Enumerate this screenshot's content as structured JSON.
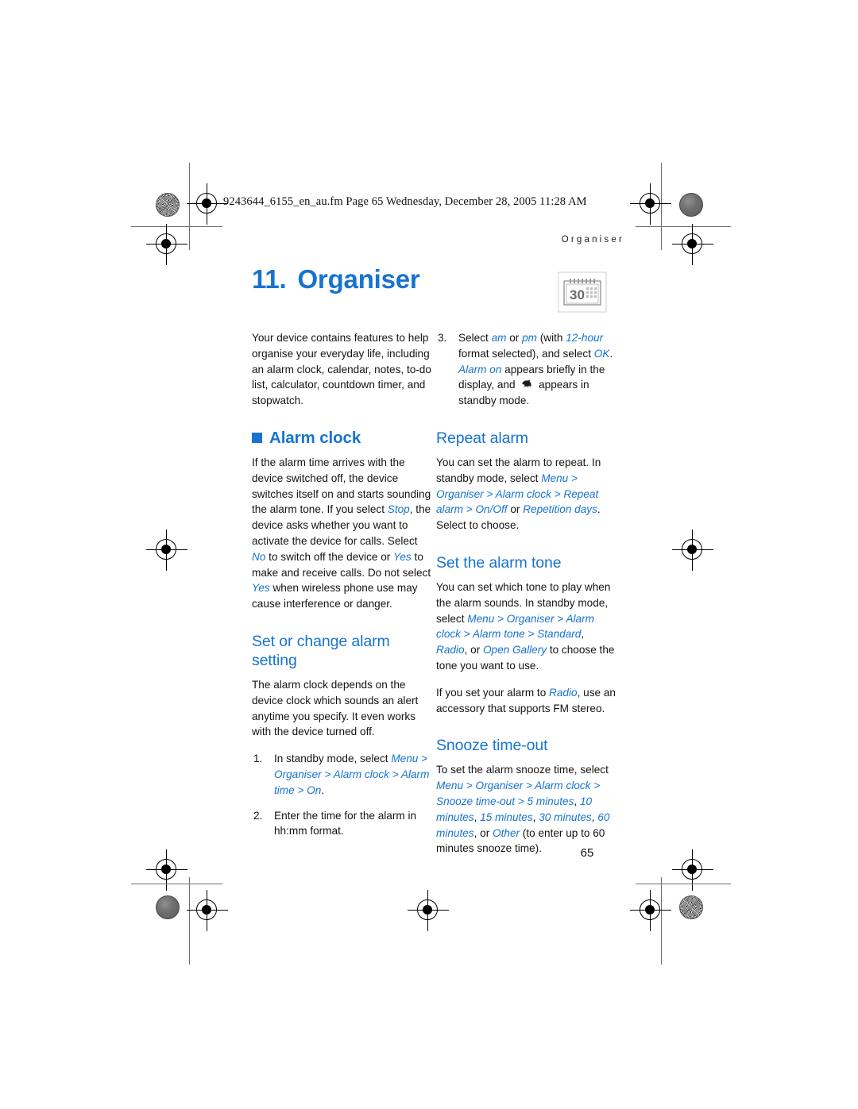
{
  "print_marks": {
    "filename_header": "9243644_6155_en_au.fm  Page 65  Wednesday, December 28, 2005  11:28 AM",
    "accent_color": "#1673d0"
  },
  "running_head": "Organiser",
  "chapter": {
    "number": "11.",
    "title": "Organiser",
    "icon": "calendar-icon",
    "icon_day": "30"
  },
  "left_column": {
    "intro": "Your device contains features to help organise your everyday life, including an alarm clock, calendar, notes, to-do list, calculator, countdown timer, and stopwatch.",
    "alarm_clock": {
      "heading": "Alarm clock",
      "para_1a": "If the alarm time arrives with the device switched off, the device switches itself on and starts sounding the alarm tone. If you select ",
      "term_stop": "Stop",
      "para_1b": ", the device asks whether you want to activate the device for calls. Select ",
      "term_no": "No",
      "para_1c": " to switch off the device or ",
      "term_yes": "Yes",
      "para_1d": " to make and receive calls. Do not select ",
      "term_yes2": "Yes",
      "para_1e": " when wireless phone use may cause interference or danger."
    },
    "set_or_change": {
      "heading": "Set or change alarm setting",
      "para": "The alarm clock depends on the device clock which sounds an alert anytime you specify. It even works with the device turned off.",
      "steps": [
        {
          "num": "1.",
          "text_a": "In standby mode, select ",
          "path": "Menu > Organiser > Alarm clock > Alarm time > On",
          "text_b": "."
        },
        {
          "num": "2.",
          "text_a": "Enter the time for the alarm in hh:mm format.",
          "path": "",
          "text_b": ""
        }
      ]
    }
  },
  "right_column": {
    "step_3": {
      "num": "3.",
      "t1": "Select ",
      "am": "am",
      "t2": " or ",
      "pm": "pm",
      "t3": " (with ",
      "fmt": "12-hour",
      "t4": " format selected), and select ",
      "ok": "OK",
      "t5": ". ",
      "alarm_on": "Alarm on",
      "t6": " appears briefly in the display, and ",
      "icon": "alarm-indicator-icon",
      "t7": " appears in standby mode."
    },
    "repeat_alarm": {
      "heading": "Repeat alarm",
      "t1": "You can set the alarm to repeat. In standby mode, select ",
      "path": "Menu > Organiser > Alarm clock > Repeat alarm > On",
      "sep": "/",
      "path2": "Off",
      "t2": " or ",
      "path3": "Repetition days",
      "t3": ". Select to choose."
    },
    "alarm_tone": {
      "heading": "Set the alarm tone",
      "t1": "You can set which tone to play when the alarm sounds. In standby mode, select ",
      "path": "Menu > Organiser > Alarm clock > Alarm tone > Standard",
      "t2": ", ",
      "radio": "Radio",
      "t3": ", or ",
      "gallery": "Open Gallery",
      "t4": " to choose the tone you want to use.",
      "p2_a": "If you set your alarm to ",
      "p2_radio": "Radio",
      "p2_b": ", use an accessory that supports FM stereo."
    },
    "snooze": {
      "heading": "Snooze time-out",
      "t1": "To set the alarm snooze time, select ",
      "path": "Menu > Organiser > Alarm clock > Snooze time-out > 5 minutes",
      "t2": ", ",
      "o10": "10 minutes",
      "t3": ", ",
      "o15": "15 minutes",
      "t4": ", ",
      "o30": "30 minutes",
      "t5": ", ",
      "o60": "60 minutes",
      "t6": ", or ",
      "other": "Other",
      "t7": " (to enter up to 60 minutes snooze time)."
    }
  },
  "page_number": "65"
}
